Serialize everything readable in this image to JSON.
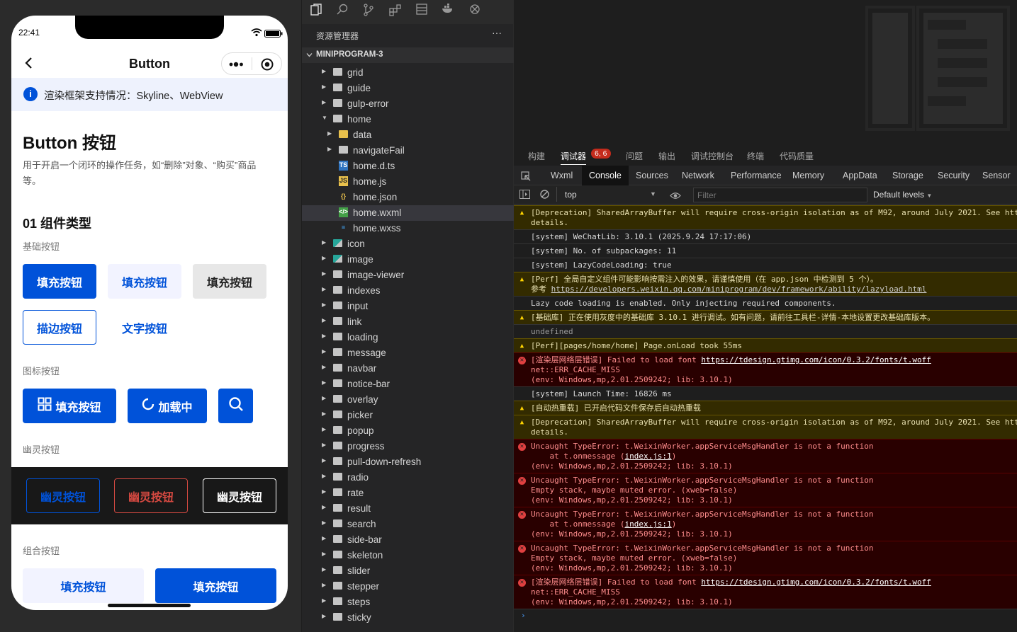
{
  "phone": {
    "time": "22:41",
    "nav_title": "Button",
    "notice": "渲染框架支持情况：Skyline、WebView",
    "page_title": "Button 按钮",
    "page_desc": "用于开启一个闭环的操作任务，如“删除”对象、“购买”商品等。",
    "section1": "01 组件类型",
    "basic_label": "基础按钮",
    "btn_fill": "填充按钮",
    "btn_outline": "描边按钮",
    "btn_text": "文字按钮",
    "icon_label": "图标按钮",
    "btn_icon_fill": "填充按钮",
    "btn_loading": "加载中",
    "ghost_label": "幽灵按钮",
    "btn_ghost": "幽灵按钮",
    "group_label": "组合按钮",
    "colors": {
      "primary": "#0052d9",
      "danger": "#d54941",
      "light": "#f2f3ff"
    }
  },
  "explorer": {
    "title": "资源管理器",
    "more": "···",
    "project": "MINIPROGRAM-3",
    "items": [
      {
        "label": "grid",
        "kind": "folder",
        "depth": 0
      },
      {
        "label": "guide",
        "kind": "folder",
        "depth": 0
      },
      {
        "label": "gulp-error",
        "kind": "folder",
        "depth": 0
      },
      {
        "label": "home",
        "kind": "folder-open",
        "depth": 0
      },
      {
        "label": "data",
        "kind": "folder-yellow",
        "depth": 1
      },
      {
        "label": "navigateFail",
        "kind": "folder",
        "depth": 1
      },
      {
        "label": "home.d.ts",
        "kind": "ts",
        "depth": 1
      },
      {
        "label": "home.js",
        "kind": "js",
        "depth": 1
      },
      {
        "label": "home.json",
        "kind": "json",
        "depth": 1
      },
      {
        "label": "home.wxml",
        "kind": "wxml",
        "depth": 1,
        "selected": true
      },
      {
        "label": "home.wxss",
        "kind": "wxss",
        "depth": 1
      },
      {
        "label": "icon",
        "kind": "folder-teal",
        "depth": 0
      },
      {
        "label": "image",
        "kind": "folder-teal",
        "depth": 0
      },
      {
        "label": "image-viewer",
        "kind": "folder",
        "depth": 0
      },
      {
        "label": "indexes",
        "kind": "folder",
        "depth": 0
      },
      {
        "label": "input",
        "kind": "folder",
        "depth": 0
      },
      {
        "label": "link",
        "kind": "folder",
        "depth": 0
      },
      {
        "label": "loading",
        "kind": "folder",
        "depth": 0
      },
      {
        "label": "message",
        "kind": "folder",
        "depth": 0
      },
      {
        "label": "navbar",
        "kind": "folder",
        "depth": 0
      },
      {
        "label": "notice-bar",
        "kind": "folder",
        "depth": 0
      },
      {
        "label": "overlay",
        "kind": "folder",
        "depth": 0
      },
      {
        "label": "picker",
        "kind": "folder",
        "depth": 0
      },
      {
        "label": "popup",
        "kind": "folder",
        "depth": 0
      },
      {
        "label": "progress",
        "kind": "folder",
        "depth": 0
      },
      {
        "label": "pull-down-refresh",
        "kind": "folder",
        "depth": 0
      },
      {
        "label": "radio",
        "kind": "folder",
        "depth": 0
      },
      {
        "label": "rate",
        "kind": "folder",
        "depth": 0
      },
      {
        "label": "result",
        "kind": "folder",
        "depth": 0
      },
      {
        "label": "search",
        "kind": "folder",
        "depth": 0
      },
      {
        "label": "side-bar",
        "kind": "folder",
        "depth": 0
      },
      {
        "label": "skeleton",
        "kind": "folder",
        "depth": 0
      },
      {
        "label": "slider",
        "kind": "folder",
        "depth": 0
      },
      {
        "label": "stepper",
        "kind": "folder",
        "depth": 0
      },
      {
        "label": "steps",
        "kind": "folder",
        "depth": 0
      },
      {
        "label": "sticky",
        "kind": "folder",
        "depth": 0
      }
    ]
  },
  "devtools": {
    "top_tabs": [
      "构建",
      "调试器",
      "问题",
      "输出",
      "调试控制台",
      "终端",
      "代码质量"
    ],
    "badge": "6, 6",
    "tabs": [
      "Wxml",
      "Console",
      "Sources",
      "Network",
      "Performance",
      "Memory",
      "AppData",
      "Storage",
      "Security",
      "Sensor"
    ],
    "context": "top",
    "filter_placeholder": "Filter",
    "levels": "Default levels",
    "logs": [
      {
        "level": "warn",
        "lines": [
          "[Deprecation] SharedArrayBuffer will require cross-origin isolation as of M92, around July 2021. See htt",
          "details."
        ]
      },
      {
        "level": "info",
        "lines": [
          "[system] WeChatLib: 3.10.1 (2025.9.24 17:17:06)"
        ]
      },
      {
        "level": "info",
        "lines": [
          "[system] No. of subpackages: 11"
        ]
      },
      {
        "level": "info",
        "lines": [
          "[system] LazyCodeLoading: true"
        ]
      },
      {
        "level": "warn",
        "lines": [
          "[Perf] 全局自定义组件可能影响按需注入的效果，请谨慎使用（在 app.json 中检测到 5 个）。",
          "参考 https://developers.weixin.qq.com/miniprogram/dev/framework/ability/lazyload.html"
        ]
      },
      {
        "level": "info",
        "lines": [
          "Lazy code loading is enabled. Only injecting required components."
        ]
      },
      {
        "level": "warn",
        "lines": [
          "[基础库] 正在使用灰度中的基础库 3.10.1 进行调试。如有问题，请前往工具栏-详情-本地设置更改基础库版本。"
        ]
      },
      {
        "level": "plain",
        "lines": [
          "undefined"
        ]
      },
      {
        "level": "warn",
        "lines": [
          "[Perf][pages/home/home] Page.onLoad took 55ms"
        ]
      },
      {
        "level": "err",
        "lines": [
          "[渲染层网络层错误] Failed to load font https://tdesign.gtimg.com/icon/0.3.2/fonts/t.woff",
          "net::ERR_CACHE_MISS",
          "(env: Windows,mp,2.01.2509242; lib: 3.10.1)"
        ]
      },
      {
        "level": "info",
        "lines": [
          "[system] Launch Time: 16826 ms"
        ]
      },
      {
        "level": "warn",
        "lines": [
          "[自动热重载] 已开启代码文件保存后自动热重载"
        ]
      },
      {
        "level": "warn",
        "lines": [
          "[Deprecation] SharedArrayBuffer will require cross-origin isolation as of M92, around July 2021. See htt",
          "details."
        ]
      },
      {
        "level": "err",
        "lines": [
          "Uncaught TypeError: t.WeixinWorker.appServiceMsgHandler is not a function",
          "    at t.onmessage (index.js:1)",
          "(env: Windows,mp,2.01.2509242; lib: 3.10.1)"
        ]
      },
      {
        "level": "err",
        "lines": [
          "Uncaught TypeError: t.WeixinWorker.appServiceMsgHandler is not a function",
          "Empty stack, maybe muted error. (xweb=false)",
          "(env: Windows,mp,2.01.2509242; lib: 3.10.1)"
        ]
      },
      {
        "level": "err",
        "lines": [
          "Uncaught TypeError: t.WeixinWorker.appServiceMsgHandler is not a function",
          "    at t.onmessage (index.js:1)",
          "(env: Windows,mp,2.01.2509242; lib: 3.10.1)"
        ]
      },
      {
        "level": "err",
        "lines": [
          "Uncaught TypeError: t.WeixinWorker.appServiceMsgHandler is not a function",
          "Empty stack, maybe muted error. (xweb=false)",
          "(env: Windows,mp,2.01.2509242; lib: 3.10.1)"
        ]
      },
      {
        "level": "err",
        "lines": [
          "[渲染层网络层错误] Failed to load font https://tdesign.gtimg.com/icon/0.3.2/fonts/t.woff",
          "net::ERR_CACHE_MISS",
          "(env: Windows,mp,2.01.2509242; lib: 3.10.1)"
        ]
      }
    ],
    "prompt": "›"
  }
}
